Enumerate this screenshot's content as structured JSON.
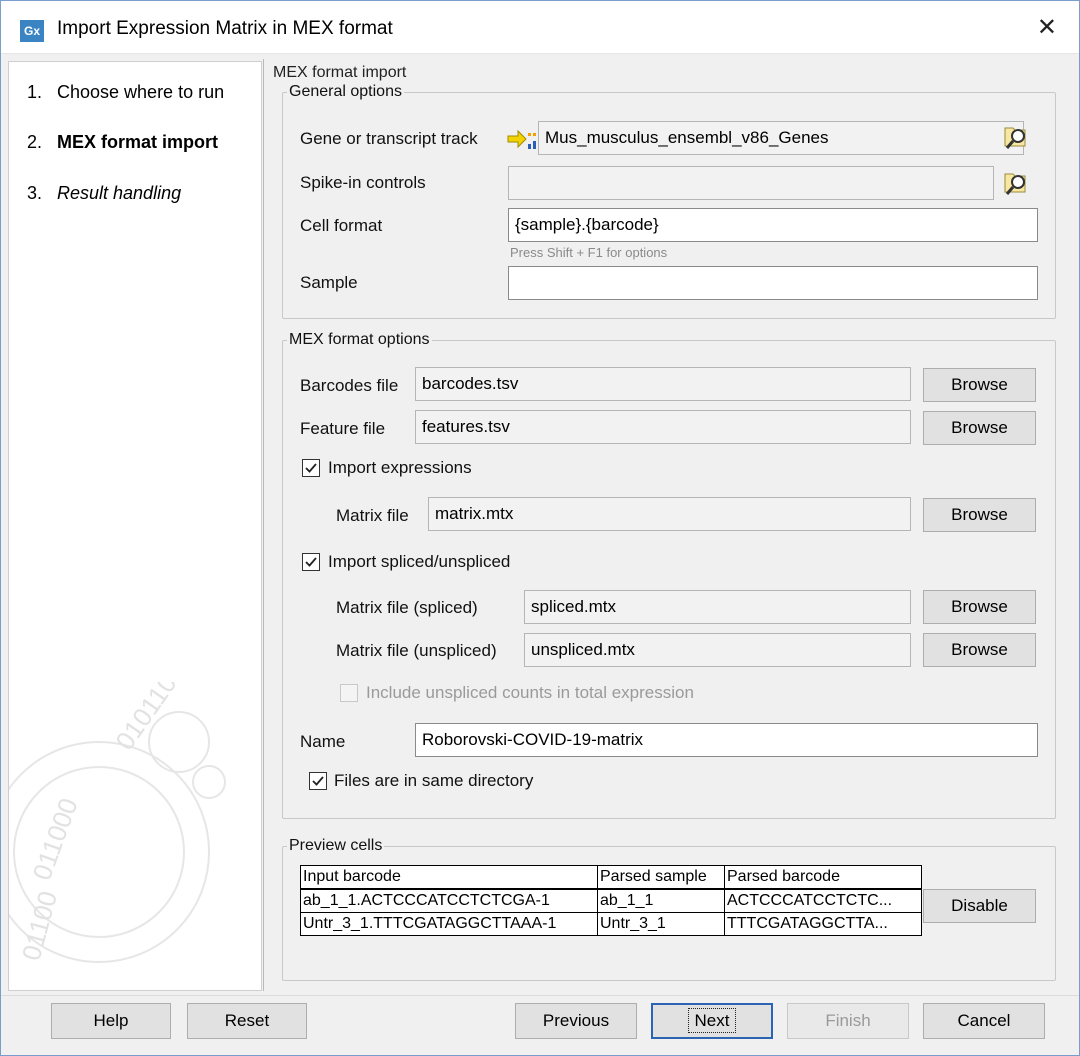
{
  "window": {
    "icon_text": "Gx",
    "title": "Import Expression Matrix in MEX format"
  },
  "steps": [
    {
      "num": "1.",
      "label": "Choose where to run"
    },
    {
      "num": "2.",
      "label": "MEX format import"
    },
    {
      "num": "3.",
      "label": "Result handling"
    }
  ],
  "section_title": "MEX format import",
  "general": {
    "legend": "General options",
    "gene_label": "Gene or transcript track",
    "gene_value": "Mus_musculus_ensembl_v86_Genes",
    "spike_label": "Spike-in controls",
    "spike_value": "",
    "cell_label": "Cell format",
    "cell_value": "{sample}.{barcode}",
    "cell_hint": "Press Shift + F1 for options",
    "sample_label": "Sample",
    "sample_value": ""
  },
  "mex": {
    "legend": "MEX format options",
    "barcodes_label": "Barcodes file",
    "barcodes_value": "barcodes.tsv",
    "feature_label": "Feature file",
    "feature_value": "features.tsv",
    "browse_label": "Browse",
    "import_expr_label": "Import expressions",
    "import_expr_checked": true,
    "matrix_label": "Matrix file",
    "matrix_value": "matrix.mtx",
    "import_spliced_label": "Import spliced/unspliced",
    "import_spliced_checked": true,
    "spliced_label": "Matrix file (spliced)",
    "spliced_value": "spliced.mtx",
    "unspliced_label": "Matrix file (unspliced)",
    "unspliced_value": "unspliced.mtx",
    "include_unspliced_label": "Include unspliced counts in total expression",
    "include_unspliced_checked": false,
    "name_label": "Name",
    "name_value": "Roborovski-COVID-19-matrix",
    "same_dir_label": "Files are in same directory",
    "same_dir_checked": true
  },
  "preview": {
    "legend": "Preview cells",
    "headers": [
      "Input barcode",
      "Parsed sample",
      "Parsed barcode"
    ],
    "rows": [
      [
        "ab_1_1.ACTCCCATCCTCTCGA-1",
        "ab_1_1",
        "ACTCCCATCCTCTC..."
      ],
      [
        "Untr_3_1.TTTCGATAGGCTTAAA-1",
        "Untr_3_1",
        "TTTCGATAGGCTTA..."
      ]
    ],
    "disable_label": "Disable"
  },
  "footer": {
    "help": "Help",
    "reset": "Reset",
    "previous": "Previous",
    "next": "Next",
    "finish": "Finish",
    "cancel": "Cancel"
  }
}
